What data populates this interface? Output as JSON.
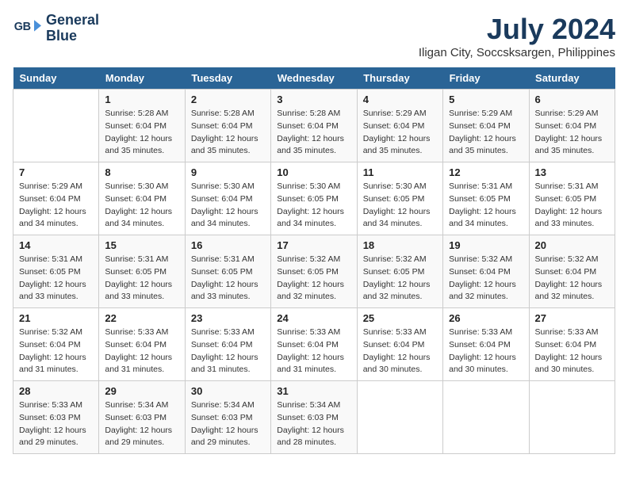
{
  "logo": {
    "line1": "General",
    "line2": "Blue"
  },
  "title": "July 2024",
  "subtitle": "Iligan City, Soccsksargen, Philippines",
  "days_header": [
    "Sunday",
    "Monday",
    "Tuesday",
    "Wednesday",
    "Thursday",
    "Friday",
    "Saturday"
  ],
  "weeks": [
    [
      {
        "day": "",
        "info": ""
      },
      {
        "day": "1",
        "info": "Sunrise: 5:28 AM\nSunset: 6:04 PM\nDaylight: 12 hours\nand 35 minutes."
      },
      {
        "day": "2",
        "info": "Sunrise: 5:28 AM\nSunset: 6:04 PM\nDaylight: 12 hours\nand 35 minutes."
      },
      {
        "day": "3",
        "info": "Sunrise: 5:28 AM\nSunset: 6:04 PM\nDaylight: 12 hours\nand 35 minutes."
      },
      {
        "day": "4",
        "info": "Sunrise: 5:29 AM\nSunset: 6:04 PM\nDaylight: 12 hours\nand 35 minutes."
      },
      {
        "day": "5",
        "info": "Sunrise: 5:29 AM\nSunset: 6:04 PM\nDaylight: 12 hours\nand 35 minutes."
      },
      {
        "day": "6",
        "info": "Sunrise: 5:29 AM\nSunset: 6:04 PM\nDaylight: 12 hours\nand 35 minutes."
      }
    ],
    [
      {
        "day": "7",
        "info": "Sunrise: 5:29 AM\nSunset: 6:04 PM\nDaylight: 12 hours\nand 34 minutes."
      },
      {
        "day": "8",
        "info": "Sunrise: 5:30 AM\nSunset: 6:04 PM\nDaylight: 12 hours\nand 34 minutes."
      },
      {
        "day": "9",
        "info": "Sunrise: 5:30 AM\nSunset: 6:04 PM\nDaylight: 12 hours\nand 34 minutes."
      },
      {
        "day": "10",
        "info": "Sunrise: 5:30 AM\nSunset: 6:05 PM\nDaylight: 12 hours\nand 34 minutes."
      },
      {
        "day": "11",
        "info": "Sunrise: 5:30 AM\nSunset: 6:05 PM\nDaylight: 12 hours\nand 34 minutes."
      },
      {
        "day": "12",
        "info": "Sunrise: 5:31 AM\nSunset: 6:05 PM\nDaylight: 12 hours\nand 34 minutes."
      },
      {
        "day": "13",
        "info": "Sunrise: 5:31 AM\nSunset: 6:05 PM\nDaylight: 12 hours\nand 33 minutes."
      }
    ],
    [
      {
        "day": "14",
        "info": "Sunrise: 5:31 AM\nSunset: 6:05 PM\nDaylight: 12 hours\nand 33 minutes."
      },
      {
        "day": "15",
        "info": "Sunrise: 5:31 AM\nSunset: 6:05 PM\nDaylight: 12 hours\nand 33 minutes."
      },
      {
        "day": "16",
        "info": "Sunrise: 5:31 AM\nSunset: 6:05 PM\nDaylight: 12 hours\nand 33 minutes."
      },
      {
        "day": "17",
        "info": "Sunrise: 5:32 AM\nSunset: 6:05 PM\nDaylight: 12 hours\nand 32 minutes."
      },
      {
        "day": "18",
        "info": "Sunrise: 5:32 AM\nSunset: 6:05 PM\nDaylight: 12 hours\nand 32 minutes."
      },
      {
        "day": "19",
        "info": "Sunrise: 5:32 AM\nSunset: 6:04 PM\nDaylight: 12 hours\nand 32 minutes."
      },
      {
        "day": "20",
        "info": "Sunrise: 5:32 AM\nSunset: 6:04 PM\nDaylight: 12 hours\nand 32 minutes."
      }
    ],
    [
      {
        "day": "21",
        "info": "Sunrise: 5:32 AM\nSunset: 6:04 PM\nDaylight: 12 hours\nand 31 minutes."
      },
      {
        "day": "22",
        "info": "Sunrise: 5:33 AM\nSunset: 6:04 PM\nDaylight: 12 hours\nand 31 minutes."
      },
      {
        "day": "23",
        "info": "Sunrise: 5:33 AM\nSunset: 6:04 PM\nDaylight: 12 hours\nand 31 minutes."
      },
      {
        "day": "24",
        "info": "Sunrise: 5:33 AM\nSunset: 6:04 PM\nDaylight: 12 hours\nand 31 minutes."
      },
      {
        "day": "25",
        "info": "Sunrise: 5:33 AM\nSunset: 6:04 PM\nDaylight: 12 hours\nand 30 minutes."
      },
      {
        "day": "26",
        "info": "Sunrise: 5:33 AM\nSunset: 6:04 PM\nDaylight: 12 hours\nand 30 minutes."
      },
      {
        "day": "27",
        "info": "Sunrise: 5:33 AM\nSunset: 6:04 PM\nDaylight: 12 hours\nand 30 minutes."
      }
    ],
    [
      {
        "day": "28",
        "info": "Sunrise: 5:33 AM\nSunset: 6:03 PM\nDaylight: 12 hours\nand 29 minutes."
      },
      {
        "day": "29",
        "info": "Sunrise: 5:34 AM\nSunset: 6:03 PM\nDaylight: 12 hours\nand 29 minutes."
      },
      {
        "day": "30",
        "info": "Sunrise: 5:34 AM\nSunset: 6:03 PM\nDaylight: 12 hours\nand 29 minutes."
      },
      {
        "day": "31",
        "info": "Sunrise: 5:34 AM\nSunset: 6:03 PM\nDaylight: 12 hours\nand 28 minutes."
      },
      {
        "day": "",
        "info": ""
      },
      {
        "day": "",
        "info": ""
      },
      {
        "day": "",
        "info": ""
      }
    ]
  ]
}
